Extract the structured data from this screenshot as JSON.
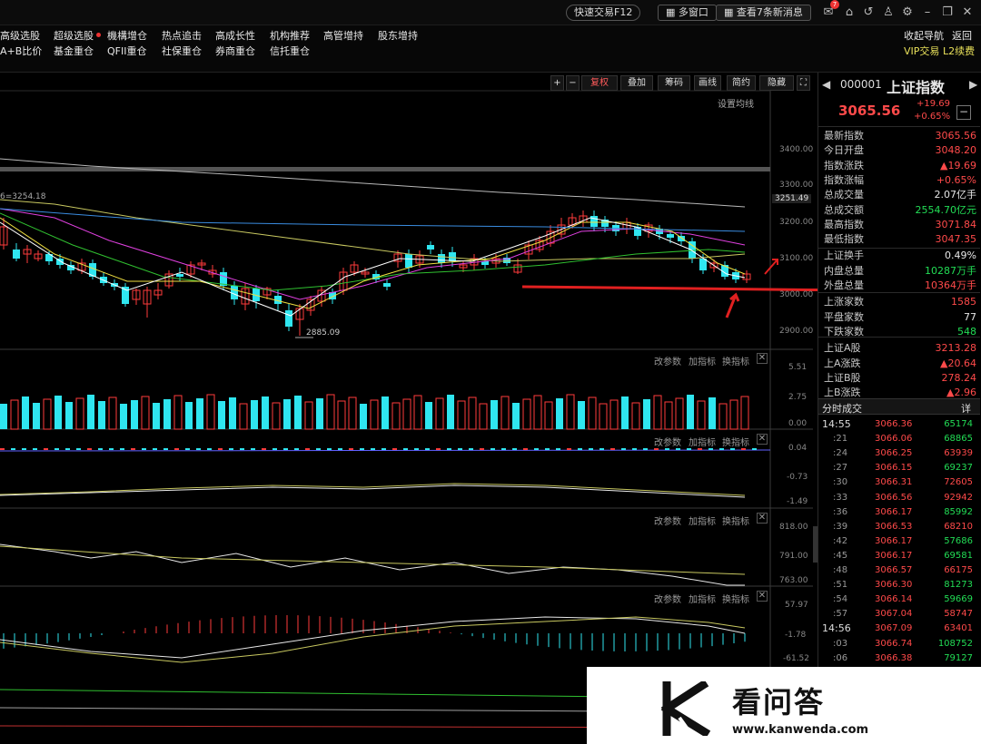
{
  "topbar": {
    "quick_trade": "快速交易F12",
    "multi_window": "多窗口",
    "news": "查看7条新消息",
    "badge": "7"
  },
  "menu": {
    "row1": [
      "高级选股",
      "超级选股",
      "機構增仓",
      "热点追击",
      "高成长性",
      "机构推荐",
      "高管增持",
      "股东增持"
    ],
    "row2": [
      "A+B比价",
      "基金重仓",
      "QFII重仓",
      "社保重仓",
      "券商重仓",
      "信托重仓"
    ],
    "right1": [
      "收起导航",
      "返回"
    ],
    "right2": [
      "VIP交易",
      "L2续费"
    ]
  },
  "toolbar": {
    "buttons": [
      "复权",
      "叠加",
      "筹码",
      "画线",
      "简约",
      "隐藏"
    ],
    "plus": "+",
    "minus": "−",
    "ma_setting": "设置均线"
  },
  "chart": {
    "ma_label": "6=3254.18",
    "low_label": "2885.09",
    "yaxis_main": [
      "3400.00",
      "3300.00",
      "3251.49",
      "3200.00",
      "3100.00",
      "3000.00",
      "2900.00"
    ],
    "panel_buttons": [
      "改参数",
      "加指标",
      "换指标"
    ],
    "vol_axis": [
      "5.51",
      "2.75",
      "0.00"
    ],
    "p2_axis": [
      "0.04",
      "-0.73",
      "-1.49"
    ],
    "p3_axis": [
      "818.00",
      "791.00",
      "763.00"
    ],
    "p4_axis": [
      "57.97",
      "-1.78",
      "-61.52"
    ],
    "colors": {
      "up": "#ff3b3b",
      "down": "#2fe6f0",
      "ma5": "#ffffff",
      "ma10": "#f0e040",
      "ma20": "#e040e0",
      "ma30": "#30c030",
      "ma60": "#a0a0a0"
    }
  },
  "quote": {
    "code": "000001",
    "name": "上证指数",
    "price": "3065.56",
    "change": "+19.69",
    "pct": "+0.65%",
    "rows": [
      {
        "label": "最新指数",
        "value": "3065.56",
        "color": "red"
      },
      {
        "label": "今日开盘",
        "value": "3048.20",
        "color": "red"
      },
      {
        "label": "指数涨跌",
        "value": "▲19.69",
        "color": "red"
      },
      {
        "label": "指数涨幅",
        "value": "+0.65%",
        "color": "red"
      },
      {
        "label": "总成交量",
        "value": "2.07亿手",
        "color": "white"
      },
      {
        "label": "总成交额",
        "value": "2554.70亿元",
        "color": "green"
      },
      {
        "label": "最高指数",
        "value": "3071.84",
        "color": "red"
      },
      {
        "label": "最低指数",
        "value": "3047.35",
        "color": "red"
      },
      {
        "label": "上证换手",
        "value": "0.49%",
        "color": "white"
      },
      {
        "label": "内盘总量",
        "value": "10287万手",
        "color": "green"
      },
      {
        "label": "外盘总量",
        "value": "10364万手",
        "color": "red"
      },
      {
        "label": "上涨家数",
        "value": "1585",
        "color": "red"
      },
      {
        "label": "平盘家数",
        "value": "77",
        "color": "white"
      },
      {
        "label": "下跌家数",
        "value": "548",
        "color": "green"
      },
      {
        "label": "上证A股",
        "value": "3213.28",
        "color": "red"
      },
      {
        "label": "上A涨跌",
        "value": "▲20.64",
        "color": "red"
      },
      {
        "label": "上证B股",
        "value": "278.24",
        "color": "red"
      },
      {
        "label": "上B涨跌",
        "value": "▲2.96",
        "color": "red"
      }
    ]
  },
  "ticks": {
    "title": "分时成交",
    "detail": "详",
    "rows": [
      {
        "t": "14:55",
        "p": "3066.36",
        "v": "65174",
        "c": "green"
      },
      {
        "t": ":21",
        "p": "3066.06",
        "v": "68865",
        "c": "green"
      },
      {
        "t": ":24",
        "p": "3066.25",
        "v": "63939",
        "c": "red"
      },
      {
        "t": ":27",
        "p": "3066.15",
        "v": "69237",
        "c": "green"
      },
      {
        "t": ":30",
        "p": "3066.31",
        "v": "72605",
        "c": "red"
      },
      {
        "t": ":33",
        "p": "3066.56",
        "v": "92942",
        "c": "red"
      },
      {
        "t": ":36",
        "p": "3066.17",
        "v": "85992",
        "c": "green"
      },
      {
        "t": ":39",
        "p": "3066.53",
        "v": "68210",
        "c": "red"
      },
      {
        "t": ":42",
        "p": "3066.17",
        "v": "57686",
        "c": "green"
      },
      {
        "t": ":45",
        "p": "3066.17",
        "v": "69581",
        "c": "green"
      },
      {
        "t": ":48",
        "p": "3066.57",
        "v": "66175",
        "c": "red"
      },
      {
        "t": ":51",
        "p": "3066.30",
        "v": "81273",
        "c": "green"
      },
      {
        "t": ":54",
        "p": "3066.14",
        "v": "59669",
        "c": "green"
      },
      {
        "t": ":57",
        "p": "3067.04",
        "v": "58747",
        "c": "red"
      },
      {
        "t": "14:56",
        "p": "3067.09",
        "v": "63401",
        "c": "red"
      },
      {
        "t": ":03",
        "p": "3066.74",
        "v": "108752",
        "c": "green"
      },
      {
        "t": ":06",
        "p": "3066.38",
        "v": "79127",
        "c": "green"
      }
    ]
  },
  "watermark": {
    "brand": "看问答",
    "url": "www.kanwenda.com"
  }
}
